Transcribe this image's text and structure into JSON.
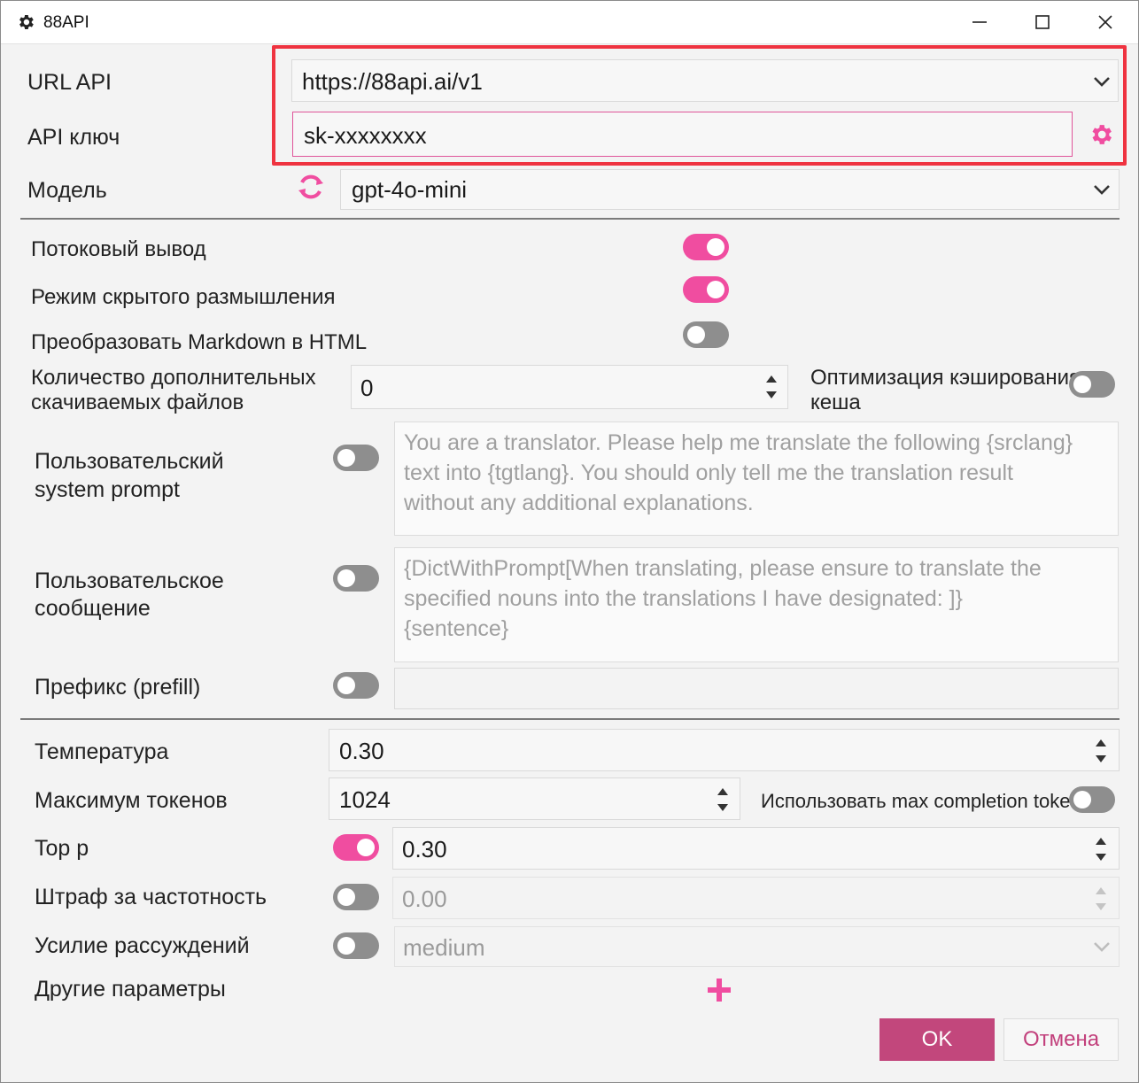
{
  "window": {
    "title": "88API"
  },
  "api": {
    "url_label": "URL API",
    "url_value": "https://88api.ai/v1",
    "key_label": "API ключ",
    "key_value": "sk-xxxxxxxx"
  },
  "model": {
    "label": "Модель",
    "value": "gpt-4o-mini"
  },
  "options": {
    "streaming_label": "Потоковый вывод",
    "streaming_on": true,
    "hidden_thinking_label": "Режим скрытого размышления",
    "hidden_thinking_on": true,
    "markdown_label": "Преобразовать Markdown в HTML",
    "markdown_on": false,
    "extra_files_label_1": "Количество дополнительных",
    "extra_files_label_2": "скачиваемых файлов",
    "extra_files_value": "0",
    "cache_label_1": "Оптимизация кэширования",
    "cache_label_2": "кеша",
    "cache_on": false
  },
  "prompts": {
    "system_label_1": "Пользовательский",
    "system_label_2": "system prompt",
    "system_on": false,
    "system_placeholder": "You are a translator. Please help me translate the following {srclang}\ntext into {tgtlang}. You should only tell me the translation result\nwithout any additional explanations.",
    "user_label_1": "Пользовательское",
    "user_label_2": "сообщение",
    "user_on": false,
    "user_placeholder": "{DictWithPrompt[When translating, please ensure to translate the\nspecified nouns into the translations I have designated: ]}\n{sentence}",
    "prefill_label": "Префикс (prefill)",
    "prefill_on": false,
    "prefill_value": ""
  },
  "params": {
    "temperature_label": "Температура",
    "temperature_value": "0.30",
    "max_tokens_label": "Максимум токенов",
    "max_tokens_value": "1024",
    "max_completion_label": "Использовать max completion tokens",
    "max_completion_on": false,
    "top_p_label": "Top p",
    "top_p_on": true,
    "top_p_value": "0.30",
    "freq_penalty_label": "Штраф за частотность",
    "freq_penalty_on": false,
    "freq_penalty_value": "0.00",
    "reasoning_label": "Усилие рассуждений",
    "reasoning_on": false,
    "reasoning_value": "medium",
    "other_label": "Другие параметры"
  },
  "buttons": {
    "ok": "OK",
    "cancel": "Отмена"
  },
  "colors": {
    "accent": "#f04da0",
    "ok_bg": "#c2477c",
    "highlight": "#ef3340"
  }
}
